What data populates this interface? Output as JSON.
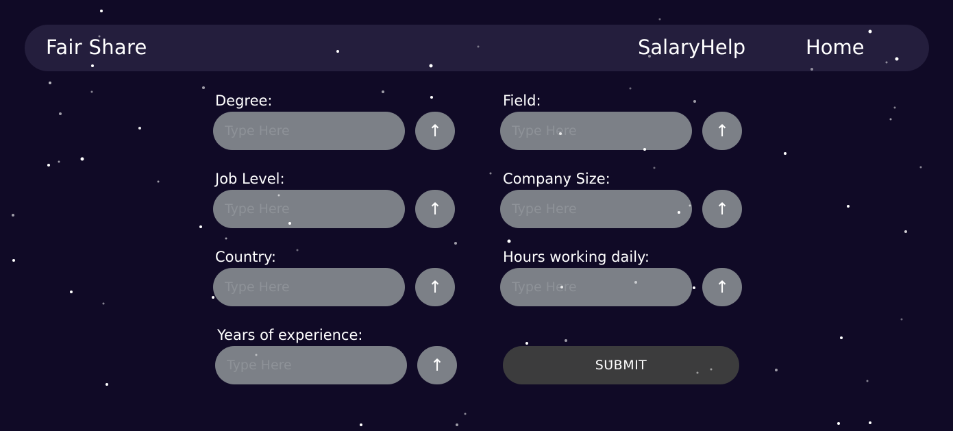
{
  "nav": {
    "brand": "Fair Share",
    "links": [
      "SalaryHelp",
      "Home"
    ]
  },
  "form": {
    "placeholder": "Type Here",
    "arrow": "↑",
    "fields": {
      "degree": "Degree:",
      "field": "Field:",
      "job_level": "Job Level:",
      "company_size": "Company Size:",
      "country": "Country:",
      "hours": "Hours working daily:",
      "years": "Years of experience:"
    },
    "submit_label": "SUBMIT"
  },
  "colors": {
    "background": "#100a26",
    "navbar": "#241e3d",
    "input": "#7c8087",
    "submit": "#3c3c3d"
  }
}
